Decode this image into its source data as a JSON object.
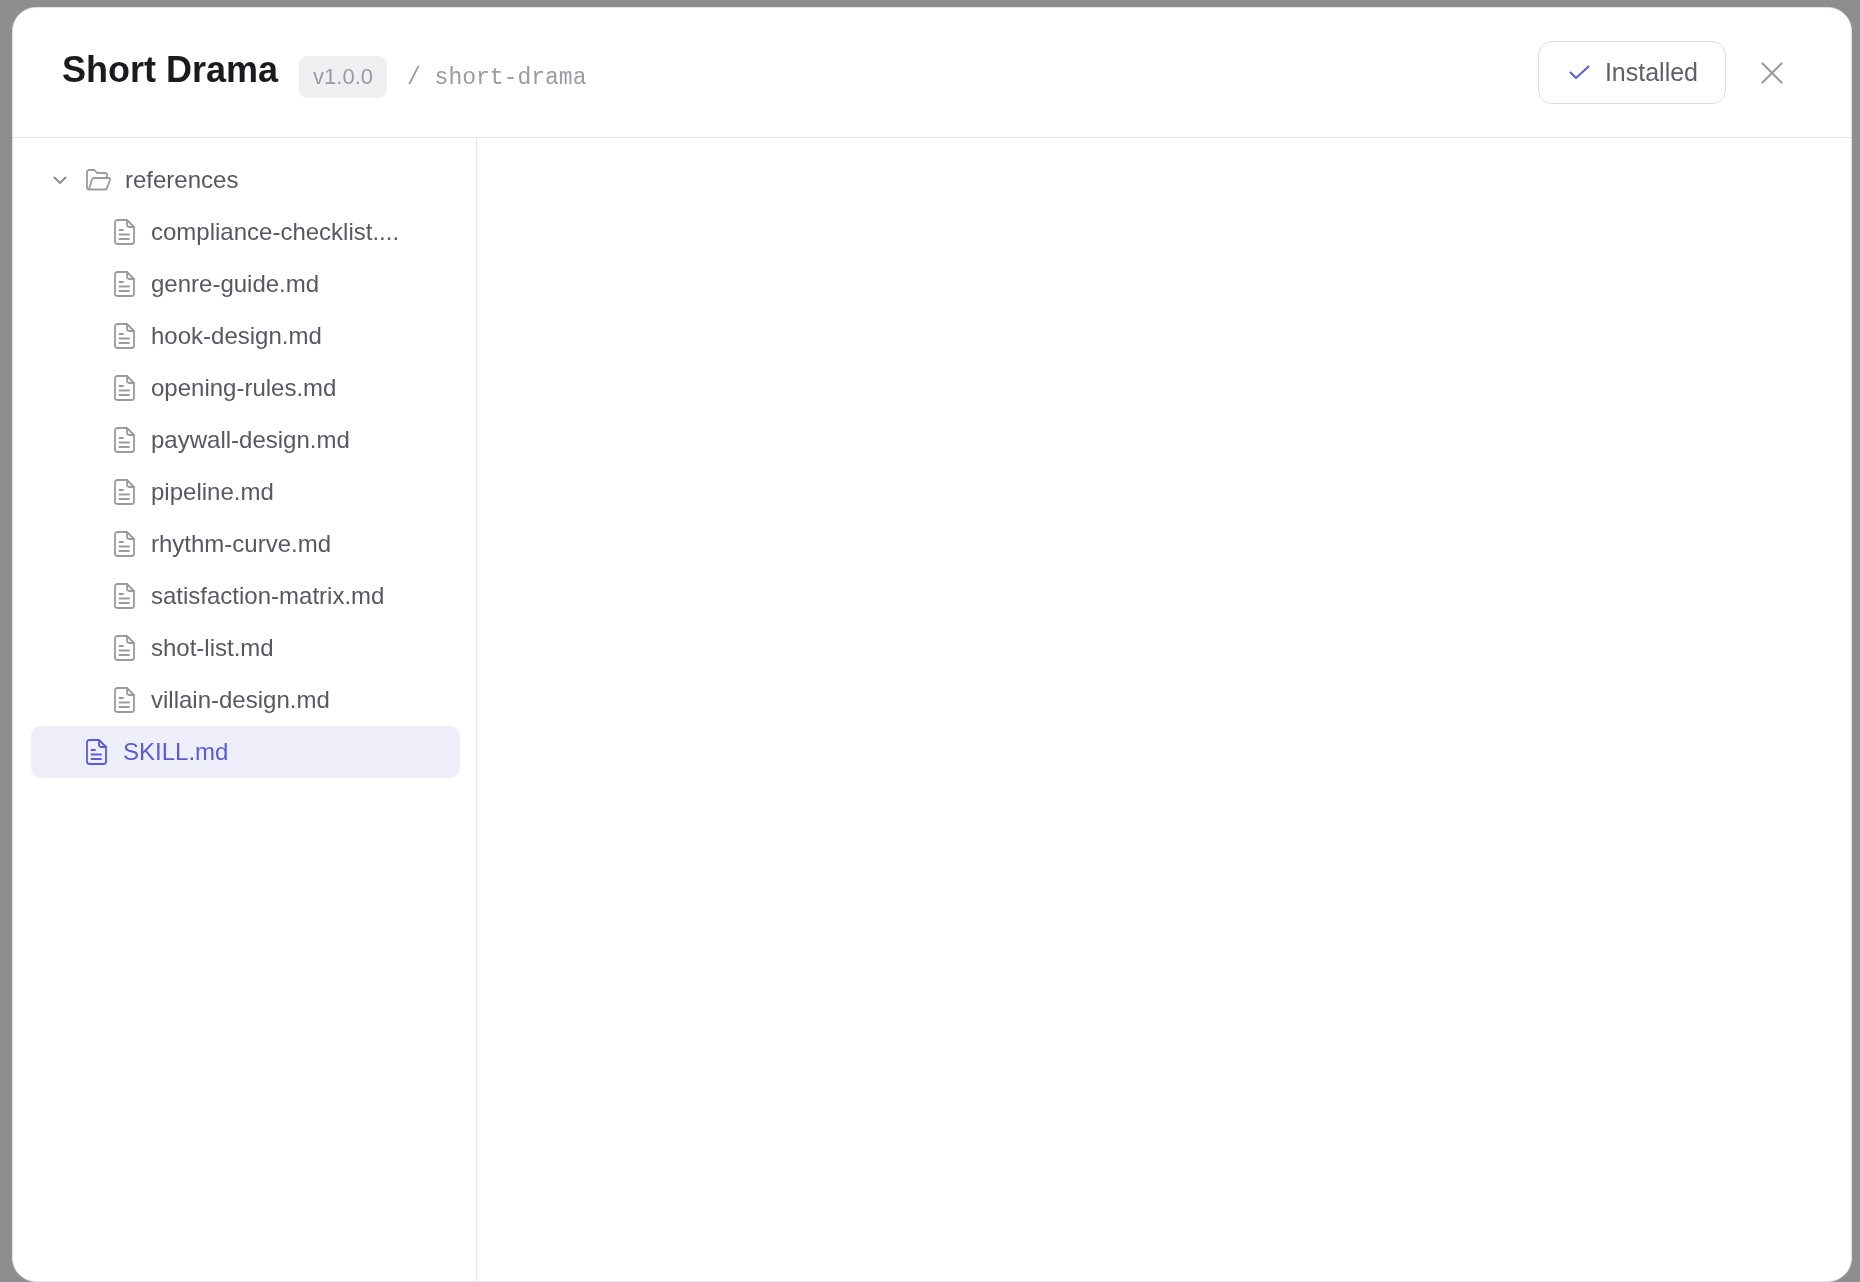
{
  "dialog": {
    "title": "Short Drama",
    "version": "v1.0.0",
    "slug": "/ short-drama",
    "status_button": {
      "label": "Installed"
    }
  },
  "file_tree": [
    {
      "name": "references",
      "kind": "folder",
      "expanded": true,
      "selected": false,
      "children": [
        {
          "name": "compliance-checklist....",
          "kind": "file",
          "selected": false
        },
        {
          "name": "genre-guide.md",
          "kind": "file",
          "selected": false
        },
        {
          "name": "hook-design.md",
          "kind": "file",
          "selected": false
        },
        {
          "name": "opening-rules.md",
          "kind": "file",
          "selected": false
        },
        {
          "name": "paywall-design.md",
          "kind": "file",
          "selected": false
        },
        {
          "name": "pipeline.md",
          "kind": "file",
          "selected": false
        },
        {
          "name": "rhythm-curve.md",
          "kind": "file",
          "selected": false
        },
        {
          "name": "satisfaction-matrix.md",
          "kind": "file",
          "selected": false
        },
        {
          "name": "shot-list.md",
          "kind": "file",
          "selected": false
        },
        {
          "name": "villain-design.md",
          "kind": "file",
          "selected": false
        }
      ]
    },
    {
      "name": "SKILL.md",
      "kind": "file",
      "selected": true
    }
  ]
}
